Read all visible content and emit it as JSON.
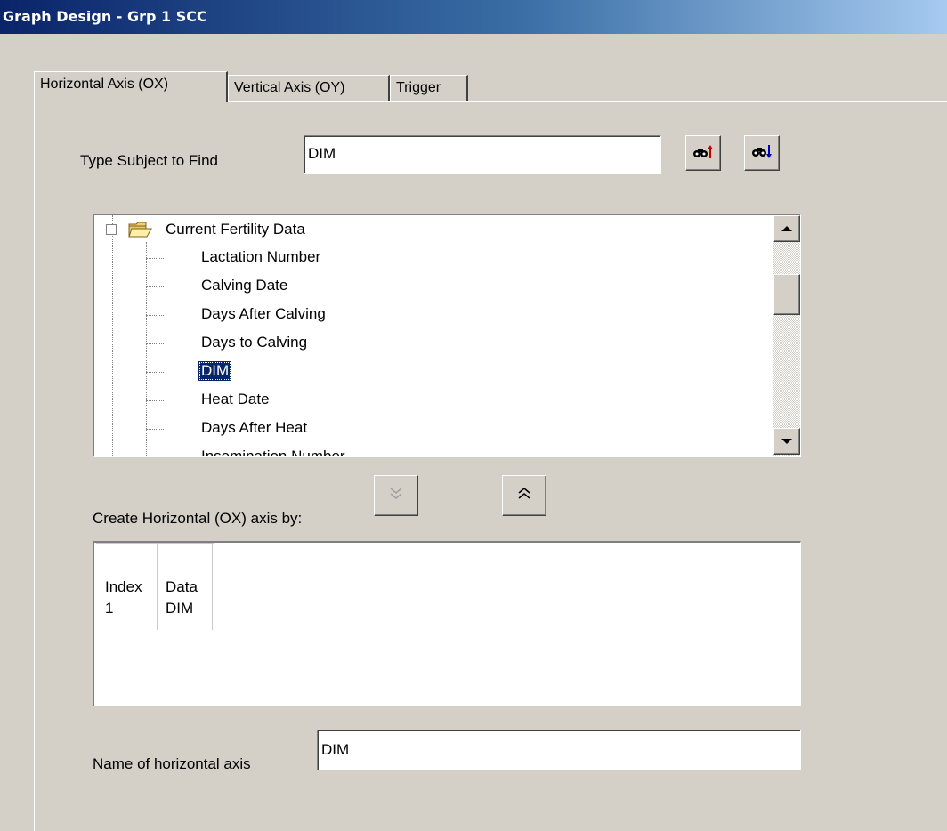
{
  "window": {
    "title": "Graph Design - Grp 1 SCC"
  },
  "tabs": [
    {
      "label": "Horizontal Axis (OX)",
      "active": true
    },
    {
      "label": "Vertical Axis (OY)",
      "active": false
    },
    {
      "label": "Trigger",
      "active": false
    }
  ],
  "find": {
    "label": "Type Subject to Find",
    "value": "DIM",
    "find_up_icon": "binoculars-up-icon",
    "find_down_icon": "binoculars-down-icon"
  },
  "tree": {
    "root": {
      "label": "Current Fertility Data",
      "expanded": true,
      "icon": "folder-open-icon"
    },
    "items": [
      {
        "label": "Lactation Number"
      },
      {
        "label": "Calving Date"
      },
      {
        "label": "Days After Calving"
      },
      {
        "label": "Days to Calving"
      },
      {
        "label": "DIM",
        "selected": true
      },
      {
        "label": "Heat Date"
      },
      {
        "label": "Days After Heat"
      },
      {
        "label": "Insemination Number"
      }
    ]
  },
  "move_buttons": {
    "down_icon": "double-chevron-down-icon",
    "up_icon": "double-chevron-up-icon"
  },
  "axis": {
    "create_label": "Create Horizontal (OX) axis by:",
    "columns": [
      "Index",
      "Data"
    ],
    "rows": [
      {
        "index": "1",
        "data": "DIM"
      }
    ],
    "name_label": "Name of horizontal axis",
    "name_value": "DIM"
  },
  "colors": {
    "selection": "#0a246a",
    "titlebar": "#0a246a",
    "face": "#d4d0c8"
  }
}
